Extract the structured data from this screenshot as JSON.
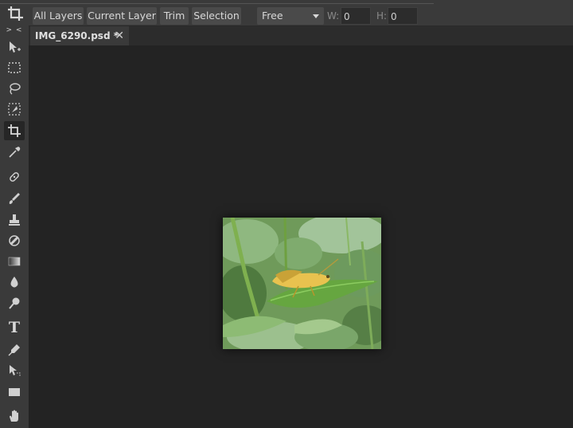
{
  "options_bar": {
    "buttons": [
      "All Layers",
      "Current Layer",
      "Trim",
      "Selection"
    ],
    "ratio_select": "Free",
    "width_label": "W:",
    "width_value": "0",
    "height_label": "H:",
    "height_value": "0"
  },
  "toolbar": {
    "collapse_label": "> <",
    "tools": [
      "move",
      "marquee",
      "lasso",
      "quick-select",
      "crop",
      "eyedropper",
      "heal",
      "brush",
      "stamp",
      "eraser",
      "gradient",
      "blur",
      "dodge",
      "type",
      "pen",
      "path-select",
      "shape",
      "hand"
    ],
    "type_glyph": "T"
  },
  "document": {
    "tab_title": "IMG_6290.psd *",
    "close_glyph": "✕"
  },
  "colors": {
    "background": "#232323",
    "panel": "#3a3a3a",
    "button": "#4a4a4a"
  }
}
